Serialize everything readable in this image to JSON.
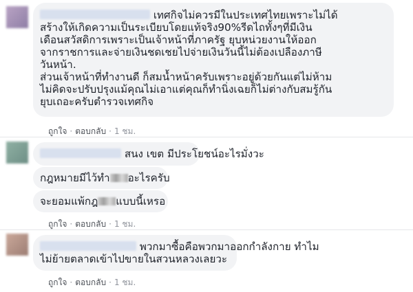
{
  "comments": [
    {
      "lines": [
        "เทศกิจไม่ควรมีในประเทศไทยเพราะไม่ได้",
        "สร้างให้เกิดความเป็นระเบียบโดยแท้จริง90%รีดไถทั้งๆที่มีเงิน",
        "เดือนสวัสดิการเพราะเป็นเจ้าหน้าที่ภาครัฐ ยุบหน่วยงานให้ออก",
        "จากราชการและจ่ายเงินชดเชยไปจ่ายเงินวันนี้ไม่ต้องเปลืองภาษี",
        "วันหน้า.",
        "ส่วนเจ้าหน้าที่ทำงานดี ก็สมน้ำหน้าครับเพราะอยู่ด้วยกันแต่ไม่ห้าม",
        "ไม่คิดจะปรับปรุงแม้คุณไม่เอาแต่คุณก็ทำนิ่งเฉยก็ไม่ต่างกับสมรู้กัน",
        "ยุบเถอะครับตำรวจเทศกิจ"
      ],
      "like": "ถูกใจ",
      "reply": "ตอบกลับ",
      "time": "1 ชม."
    },
    {
      "line1": "สนง เขต มีประโยชน์อะไรมั่งวะ",
      "line2_before": "กฎหมายมีไว้ทำ",
      "line2_after": "อะไรครับ",
      "line3_before": "จะยอมแพ้กฎ",
      "line3_after": "แบบนี้เหรอ",
      "like": "ถูกใจ",
      "reply": "ตอบกลับ",
      "time": "1 ชม."
    },
    {
      "lines": [
        "พวกมาซื้อคือพวกมาออกกำลังกาย ทำไม",
        "ไม่ย้ายตลาดเข้าไปขายในสวนหลวงเลยวะ"
      ],
      "like": "ถูกใจ",
      "reply": "ตอบกลับ",
      "time": "1 ชม."
    }
  ]
}
